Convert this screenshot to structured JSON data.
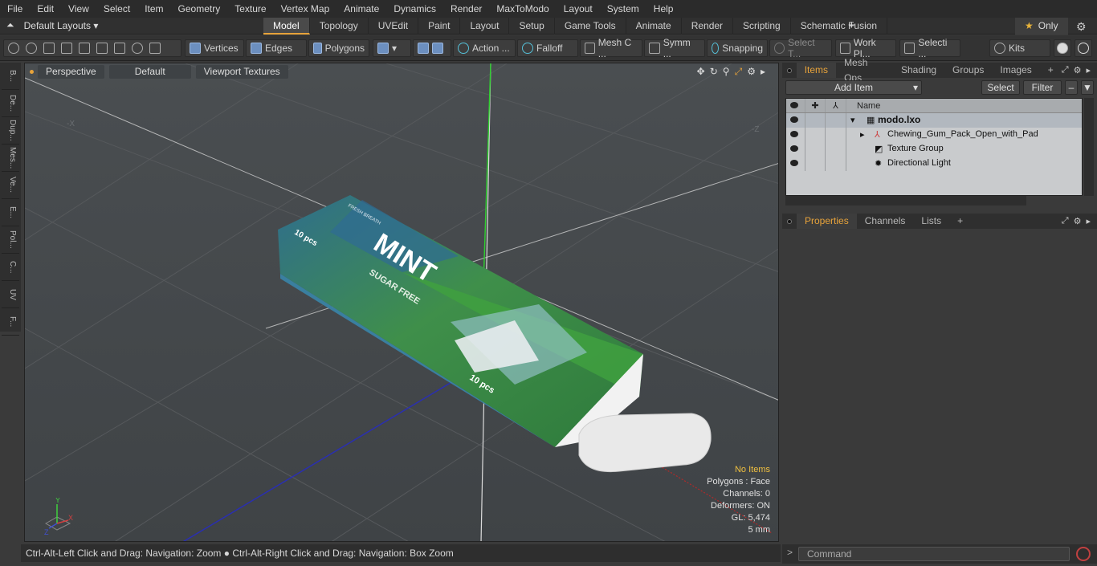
{
  "menu": [
    "File",
    "Edit",
    "View",
    "Select",
    "Item",
    "Geometry",
    "Texture",
    "Vertex Map",
    "Animate",
    "Dynamics",
    "Render",
    "MaxToModo",
    "Layout",
    "System",
    "Help"
  ],
  "layout": {
    "name": "Default Layouts",
    "tabs": [
      "Model",
      "Topology",
      "UVEdit",
      "Paint",
      "Layout",
      "Setup",
      "Game Tools",
      "Animate",
      "Render",
      "Scripting",
      "Schematic Fusion"
    ],
    "active_tab": "Model",
    "only": "Only"
  },
  "toolbar": {
    "vertices": "Vertices",
    "edges": "Edges",
    "polygons": "Polygons",
    "action": "Action ...",
    "falloff": "Falloff",
    "mesh": "Mesh C ...",
    "symm": "Symm ...",
    "snapping": "Snapping",
    "select_t": "Select T...",
    "workpl": "Work Pl...",
    "selecti": "Selecti ...",
    "kits": "Kits"
  },
  "leftstrip": [
    "B...",
    "De...",
    "Dup...",
    "Mes...",
    "Ve...",
    "E...",
    "Pol...",
    "C...",
    "UV",
    "F..."
  ],
  "viewport": {
    "view": "Perspective",
    "shading": "Default",
    "textures": "Viewport Textures",
    "label_x": "-X",
    "label_z": "-Z",
    "stats": {
      "items": "No Items",
      "polygons": "Polygons : Face",
      "channels": "Channels: 0",
      "deformers": "Deformers: ON",
      "gl": "GL: 5,474",
      "scale": "5 mm"
    },
    "gum": {
      "brand": "MINT",
      "sub": "SUGAR FREE",
      "count": "10 pcs",
      "count2": "10 pcs",
      "small": "FRESH BREATH"
    },
    "axes": {
      "x": "X",
      "y": "Y",
      "z": "Z"
    }
  },
  "status": "Ctrl-Alt-Left Click and Drag: Navigation: Zoom ● Ctrl-Alt-Right Click and Drag: Navigation: Box Zoom",
  "items_panel": {
    "tabs": [
      "Items",
      "Mesh Ops",
      "Shading",
      "Groups",
      "Images"
    ],
    "active": "Items",
    "add_item": "Add Item",
    "select": "Select",
    "filter": "Filter",
    "col_name": "Name",
    "rows": [
      "modo.lxo",
      "Chewing_Gum_Pack_Open_with_Pad",
      "Texture Group",
      "Directional Light"
    ]
  },
  "props_panel": {
    "tabs": [
      "Properties",
      "Channels",
      "Lists"
    ],
    "active": "Properties"
  },
  "command": {
    "placeholder": "Command",
    "prompt": ">"
  },
  "colors": {
    "accent": "#e8a33a",
    "viewport": "#4b4f52"
  }
}
